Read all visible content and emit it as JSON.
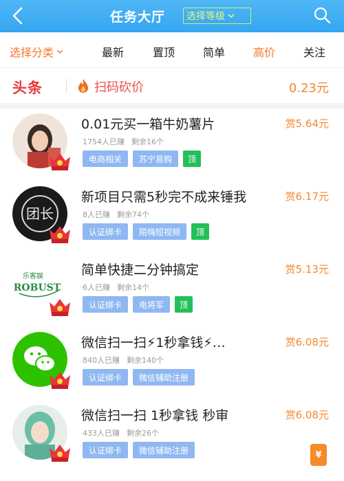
{
  "header": {
    "title": "任务大厅",
    "level_select": "选择等级",
    "colors": {
      "bg": "#3aa8f2",
      "accent": "#e9f77c"
    }
  },
  "tabs": [
    {
      "label": "选择分类",
      "has_dropdown": true,
      "active": false
    },
    {
      "label": "最新",
      "active": false
    },
    {
      "label": "置顶",
      "active": false
    },
    {
      "label": "简单",
      "active": false
    },
    {
      "label": "高价",
      "active": true
    },
    {
      "label": "关注",
      "active": false
    }
  ],
  "headline": {
    "tag": "头条",
    "text": "扫码砍价",
    "price": "0.23元",
    "icon": "fire-icon"
  },
  "tasks": [
    {
      "title": "0.01元买一箱牛奶薯片",
      "reward": "赏5.64元",
      "done": "1754人已赚",
      "remaining": "剩余16个",
      "tags": [
        "电商相关",
        "苏宁易购"
      ],
      "top": "顶"
    },
    {
      "title": "新项目只需5秒完不成来锤我",
      "reward": "赏6.17元",
      "done": "8人已赚",
      "remaining": "剩余74个",
      "tags": [
        "认证绑卡",
        "陌嗨短视频"
      ],
      "top": "顶"
    },
    {
      "title": "简单快捷二分钟搞定",
      "reward": "赏5.13元",
      "done": "6人已赚",
      "remaining": "剩余14个",
      "tags": [
        "认证绑卡",
        "电将军"
      ],
      "top": "顶"
    },
    {
      "title": "微信扫一扫⚡1秒拿钱⚡…",
      "reward": "赏6.08元",
      "done": "840人已赚",
      "remaining": "剩余140个",
      "tags": [
        "认证绑卡",
        "微信辅助注册"
      ],
      "top": ""
    },
    {
      "title": "微信扫一扫 1秒拿钱 秒审",
      "reward": "赏6.08元",
      "done": "433人已赚",
      "remaining": "剩余26个",
      "tags": [
        "认证绑卡",
        "微信辅助注册"
      ],
      "top": ""
    }
  ],
  "float_badge": "¥",
  "colors": {
    "orange": "#f5882e",
    "red": "#e83a3a",
    "tag_blue": "#8fb8f2",
    "top_green": "#23c05a"
  }
}
